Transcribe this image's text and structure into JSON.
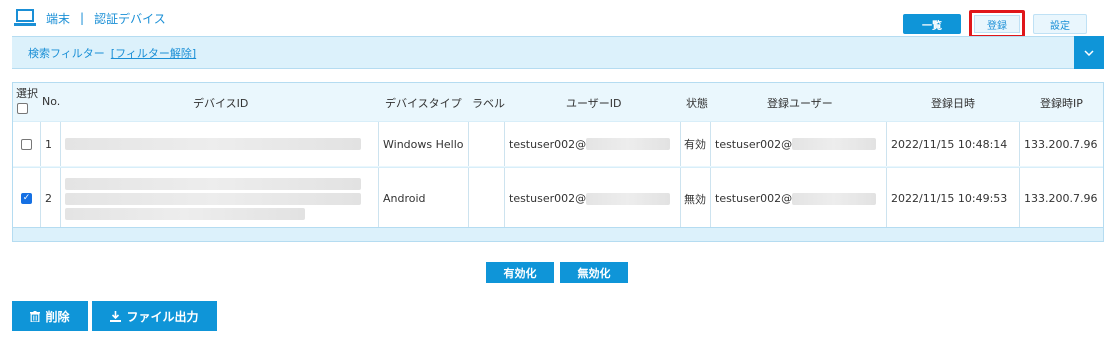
{
  "header": {
    "section": "端末",
    "separator": "|",
    "page": "認証デバイス"
  },
  "top_buttons": {
    "list": "一覧",
    "register": "登録",
    "settings": "設定"
  },
  "filter": {
    "label": "検索フィルター",
    "clear_link": "[フィルター解除]"
  },
  "table": {
    "select_label": "選択",
    "columns": {
      "no": "No.",
      "device_id": "デバイスID",
      "device_type": "デバイスタイプ",
      "label": "ラベル",
      "user_id": "ユーザーID",
      "status": "状態",
      "reg_user": "登録ユーザー",
      "reg_date": "登録日時",
      "reg_ip": "登録時IP"
    },
    "rows": [
      {
        "checked": false,
        "no": "1",
        "device_type": "Windows Hello",
        "label": "",
        "user_id": "testuser002@",
        "status": "有効",
        "reg_user": "testuser002@",
        "reg_date": "2022/11/15 10:48:14",
        "reg_ip": "133.200.7.96"
      },
      {
        "checked": true,
        "no": "2",
        "device_type": "Android",
        "label": "",
        "user_id": "testuser002@",
        "status": "無効",
        "reg_user": "testuser002@",
        "reg_date": "2022/11/15 10:49:53",
        "reg_ip": "133.200.7.96"
      }
    ]
  },
  "actions": {
    "enable": "有効化",
    "disable": "無効化",
    "delete": "削除",
    "export": "ファイル出力"
  },
  "colors": {
    "primary": "#0f95d8",
    "highlight": "#e0161a",
    "header_bg": "#dcf1fb"
  }
}
